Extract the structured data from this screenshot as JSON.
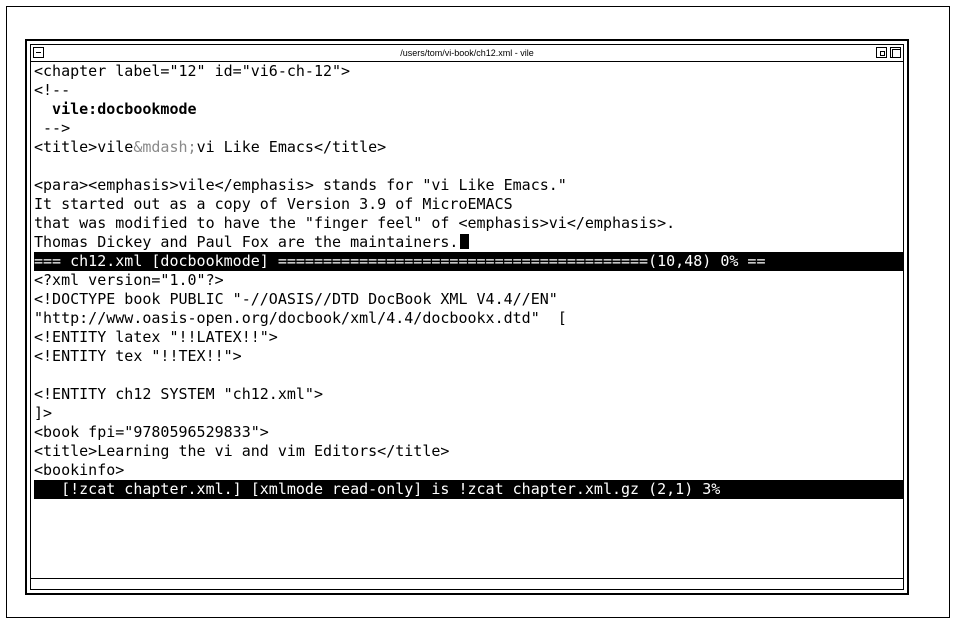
{
  "window": {
    "title": "/users/tom/vi-book/ch12.xml - vile"
  },
  "upper_buffer": {
    "lines": {
      "l1": "<chapter label=\"12\" id=\"vi6-ch-12\">",
      "l2": "<!--",
      "l3": "  vile:docbookmode",
      "l4": " -->",
      "l5a": "<title>vile",
      "l5b": "&mdash;",
      "l5c": "vi Like Emacs</title>",
      "l6": "",
      "l7": "<para><emphasis>vile</emphasis> stands for \"vi Like Emacs.\"",
      "l8": "It started out as a copy of Version 3.9 of MicroEMACS",
      "l9a": "that was modified to have the \"finger feel\" of ",
      "l9b": "<emphasis>vi</emphasis>.",
      "l10": "Thomas Dickey and Paul Fox are the maintainers."
    }
  },
  "modeline_top": "=== ch12.xml [docbookmode] =========================================(10,48) 0% ==",
  "lower_buffer": {
    "lines": {
      "l1": "<?xml version=\"1.0\"?>",
      "l2": "<!DOCTYPE book PUBLIC \"-//OASIS//DTD DocBook XML V4.4//EN\"",
      "l3": "\"http://www.oasis-open.org/docbook/xml/4.4/docbookx.dtd\"  [",
      "l4": "<!ENTITY latex \"!!LATEX!!\">",
      "l5": "<!ENTITY tex \"!!TEX!!\">",
      "l6": "",
      "l7": "<!ENTITY ch12 SYSTEM \"ch12.xml\">",
      "l8": "]>",
      "l9": "<book fpi=\"9780596529833\">",
      "l10": "<title>Learning the vi and vim Editors</title>",
      "l11": "<bookinfo>"
    }
  },
  "modeline_bottom": "   [!zcat chapter.xml.] [xmlmode read-only] is !zcat chapter.xml.gz (2,1) 3%",
  "colors": {
    "text": "#000000",
    "entity_highlight": "#8a8a8a",
    "modeline_bg": "#000000",
    "modeline_fg": "#ffffff"
  },
  "icons": [
    "window-menu-icon",
    "minimize-icon",
    "maximize-icon"
  ]
}
